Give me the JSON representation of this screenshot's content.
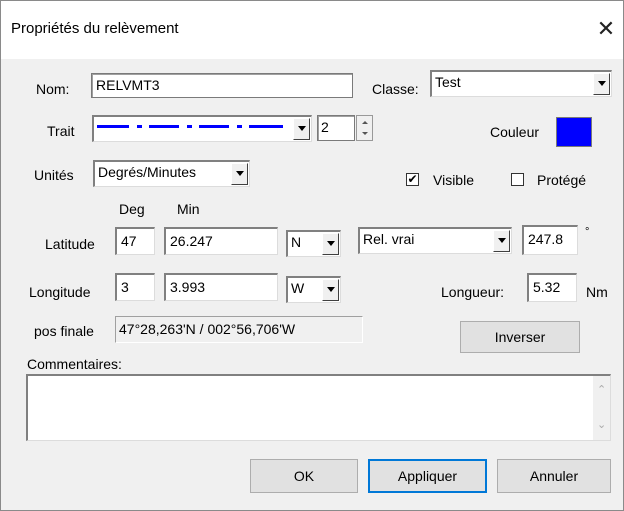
{
  "window": {
    "title": "Propriétés du relèvement",
    "close_glyph": "✕"
  },
  "nom": {
    "label": "Nom:",
    "value": "RELVMT3"
  },
  "classe": {
    "label": "Classe:",
    "value": "Test"
  },
  "trait": {
    "label": "Trait",
    "width_value": "2"
  },
  "couleur": {
    "label": "Couleur",
    "color": "#0000ff"
  },
  "unites": {
    "label": "Unités",
    "value": "Degrés/Minutes"
  },
  "visible": {
    "label": "Visible",
    "checked": true
  },
  "protege": {
    "label": "Protégé",
    "checked": false
  },
  "headers": {
    "deg": "Deg",
    "min": "Min"
  },
  "latitude": {
    "label": "Latitude",
    "deg": "47",
    "min": "26.247",
    "hemi": "N"
  },
  "longitude": {
    "label": "Longitude",
    "deg": "3",
    "min": "3.993",
    "hemi": "W"
  },
  "bearing": {
    "type": "Rel. vrai",
    "value": "247.8",
    "unit": "°"
  },
  "longueur": {
    "label": "Longueur:",
    "value": "5.32",
    "unit": "Nm"
  },
  "pos_finale": {
    "label": "pos finale",
    "value": "47°28,263'N / 002°56,706'W"
  },
  "inverser_label": "Inverser",
  "commentaires": {
    "label": "Commentaires:",
    "value": ""
  },
  "buttons": {
    "ok": "OK",
    "apply": "Appliquer",
    "cancel": "Annuler"
  },
  "colors": {
    "line_color": "#0000ff",
    "focus_border": "#0078d7"
  }
}
